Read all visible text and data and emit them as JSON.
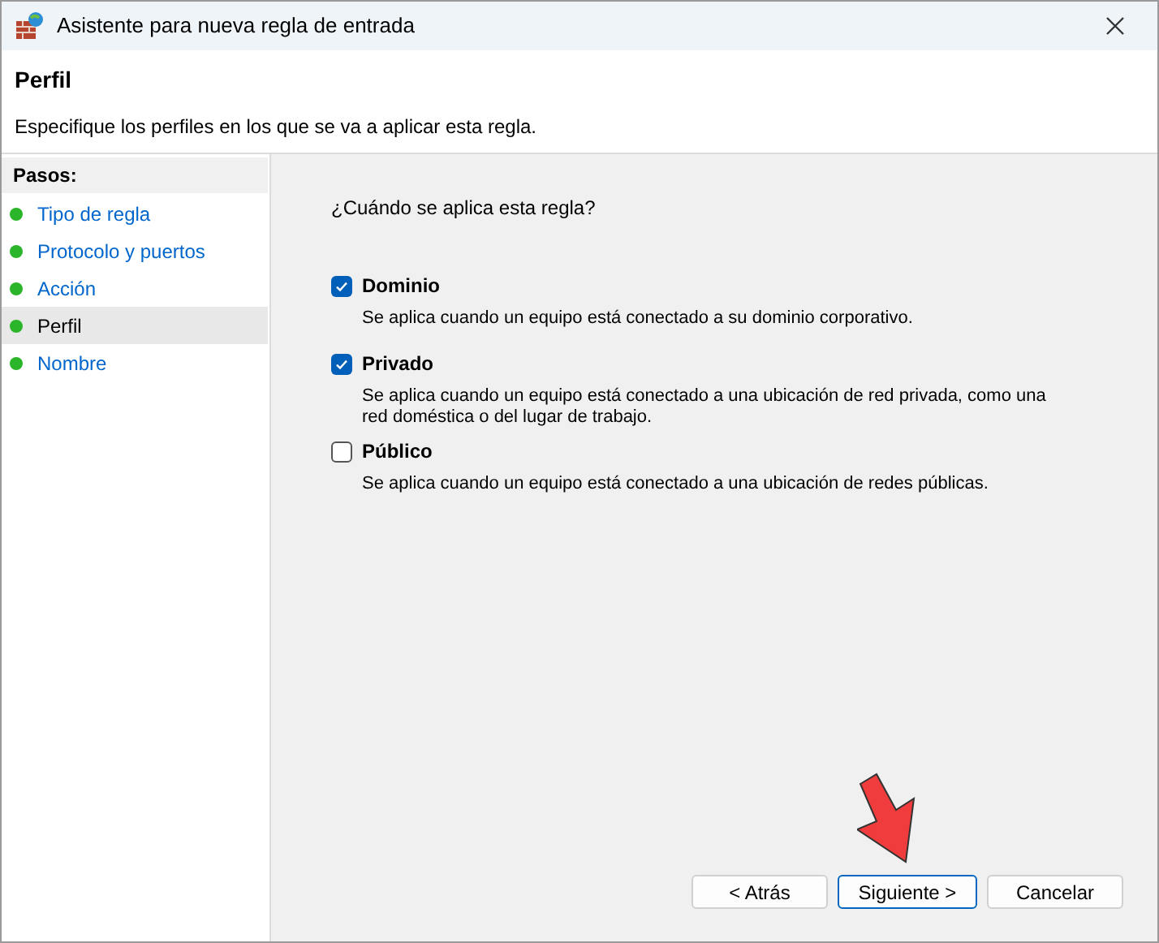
{
  "window": {
    "title": "Asistente para nueva regla de entrada"
  },
  "header": {
    "title": "Perfil",
    "description": "Especifique los perfiles en los que se va a aplicar esta regla."
  },
  "steps": {
    "title": "Pasos:",
    "items": [
      {
        "label": "Tipo de regla",
        "selected": false
      },
      {
        "label": "Protocolo y puertos",
        "selected": false
      },
      {
        "label": "Acción",
        "selected": false
      },
      {
        "label": "Perfil",
        "selected": true
      },
      {
        "label": "Nombre",
        "selected": false
      }
    ]
  },
  "question": "¿Cuándo se aplica esta regla?",
  "options": [
    {
      "label": "Dominio",
      "checked": true,
      "description": "Se aplica cuando un equipo está conectado a su dominio corporativo."
    },
    {
      "label": "Privado",
      "checked": true,
      "description": "Se aplica cuando un equipo está conectado a una ubicación de red privada, como una red doméstica o del lugar de trabajo."
    },
    {
      "label": "Público",
      "checked": false,
      "description": "Se aplica cuando un equipo está conectado a una ubicación de redes públicas."
    }
  ],
  "buttons": [
    {
      "label": "< Atrás",
      "focused": false
    },
    {
      "label": "Siguiente >",
      "focused": true
    },
    {
      "label": "Cancelar",
      "focused": false
    }
  ]
}
